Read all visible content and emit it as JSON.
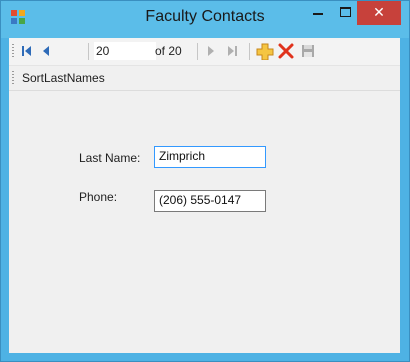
{
  "window": {
    "title": "Faculty Contacts",
    "close_glyph": "✕"
  },
  "navigator": {
    "position": "20",
    "count_label": "of 20"
  },
  "menu": {
    "item": "SortLastNames"
  },
  "form": {
    "last_name_label": "Last Name:",
    "last_name_value": "Zimprich",
    "phone_label": "Phone:",
    "phone_value": "(206) 555-0147"
  },
  "colors": {
    "titlebar": "#5bbde9",
    "close_button": "#c7413b",
    "nav_arrows": "#2e6bb8",
    "add_icon": "#e6a415",
    "delete_icon": "#e0321c"
  }
}
